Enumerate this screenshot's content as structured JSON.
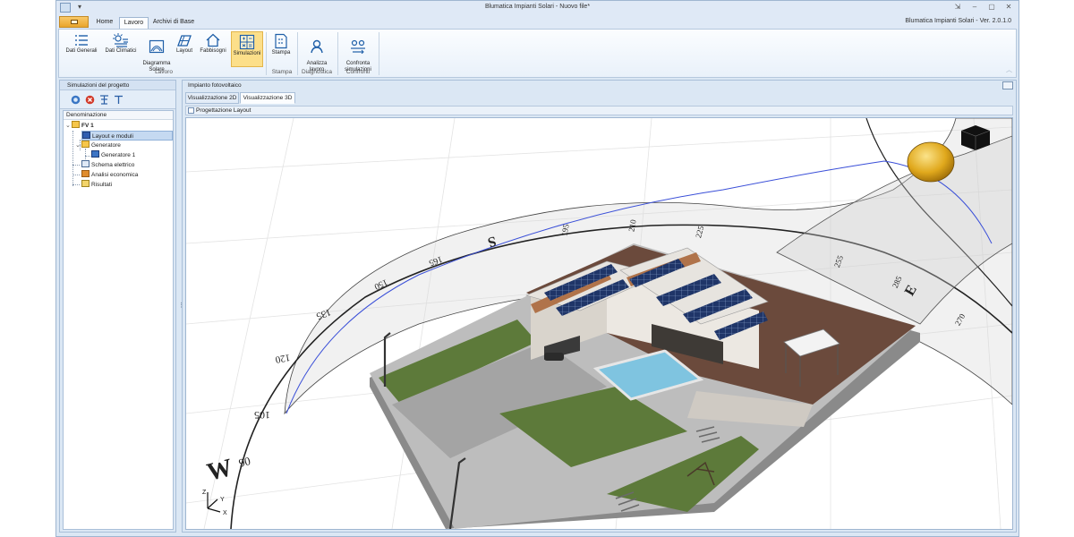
{
  "window": {
    "title": "Blumatica Impianti Solari - Nuovo file*",
    "version": "Blumatica Impianti Solari - Ver. 2.0.1.0",
    "qat": "▾"
  },
  "ribbon": {
    "tabs": [
      {
        "label": "Home"
      },
      {
        "label": "Lavoro",
        "active": true
      },
      {
        "label": "Archivi di Base"
      }
    ],
    "buttons": {
      "dati_generali": "Dati Generali",
      "dati_climatici": "Dati Climatici",
      "diagramma_solare": "Diagramma\nSolare",
      "layout": "Layout",
      "fabbisogni": "Fabbisogni",
      "simulazioni": "Simulazioni",
      "stampa": "Stampa",
      "analizza_lavoro": "Analizza\nlavoro",
      "confronta_simulazioni": "Confronta\nsimulazioni"
    },
    "groups": {
      "lavoro": "Lavoro",
      "stampa": "Stampa",
      "diagnostica": "Diagnostica",
      "confronti": "Confronti"
    }
  },
  "left_panel": {
    "title": "Simulazioni del progetto",
    "column_header": "Denominazione",
    "tree": {
      "fv1": "FV 1",
      "layout_moduli": "Layout e moduli",
      "generatore": "Generatore",
      "generatore_1": "Generatore 1",
      "schema_elettrico": "Schema elettrico",
      "analisi_economica": "Analisi economica",
      "risultati": "Risultati"
    }
  },
  "right_panel": {
    "title": "Impianto fotovoltaico",
    "tabs": {
      "vis2d": "Visualizzazione 2D",
      "vis3d": "Visualizzazione 3D"
    },
    "subheader": "Progettazione Layout"
  },
  "viewport": {
    "compass": {
      "w": "W",
      "e": "E",
      "s": "S",
      "angles": [
        "90",
        "105",
        "120",
        "135",
        "150",
        "165",
        "195",
        "210",
        "225",
        "255",
        "270",
        "285"
      ]
    },
    "axes": {
      "z": "Z",
      "y": "Y",
      "x": "X"
    },
    "colors": {
      "sun": "#e0a81c",
      "sun_path": "#3a4fd8",
      "roof": "#6b4a3c",
      "panel": "#1f3568",
      "grass": "#5d7a3a",
      "pool": "#7fc4e0"
    }
  }
}
